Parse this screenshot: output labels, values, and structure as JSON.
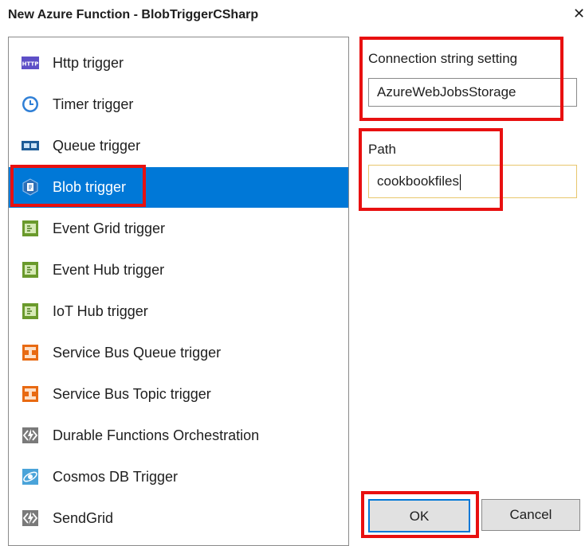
{
  "dialog": {
    "title": "New Azure Function - BlobTriggerCSharp",
    "close_glyph": "✕"
  },
  "templates": [
    {
      "label": "Http trigger",
      "icon": "http-icon"
    },
    {
      "label": "Timer trigger",
      "icon": "clock-icon"
    },
    {
      "label": "Queue trigger",
      "icon": "queue-icon"
    },
    {
      "label": "Blob trigger",
      "icon": "blob-icon",
      "selected": true
    },
    {
      "label": "Event Grid trigger",
      "icon": "event-grid-icon"
    },
    {
      "label": "Event Hub trigger",
      "icon": "event-hub-icon"
    },
    {
      "label": "IoT Hub trigger",
      "icon": "iot-hub-icon"
    },
    {
      "label": "Service Bus Queue trigger",
      "icon": "service-bus-icon"
    },
    {
      "label": "Service Bus Topic trigger",
      "icon": "service-bus-icon"
    },
    {
      "label": "Durable Functions Orchestration",
      "icon": "function-icon"
    },
    {
      "label": "Cosmos DB Trigger",
      "icon": "cosmos-db-icon"
    },
    {
      "label": "SendGrid",
      "icon": "function-icon"
    }
  ],
  "settings": {
    "connection_label": "Connection string setting",
    "connection_value": "AzureWebJobsStorage",
    "path_label": "Path",
    "path_value": "cookbookfiles"
  },
  "buttons": {
    "ok": "OK",
    "cancel": "Cancel"
  },
  "colors": {
    "selection": "#0078d7",
    "highlight": "#e81010",
    "focus_border": "#e8c66c"
  }
}
